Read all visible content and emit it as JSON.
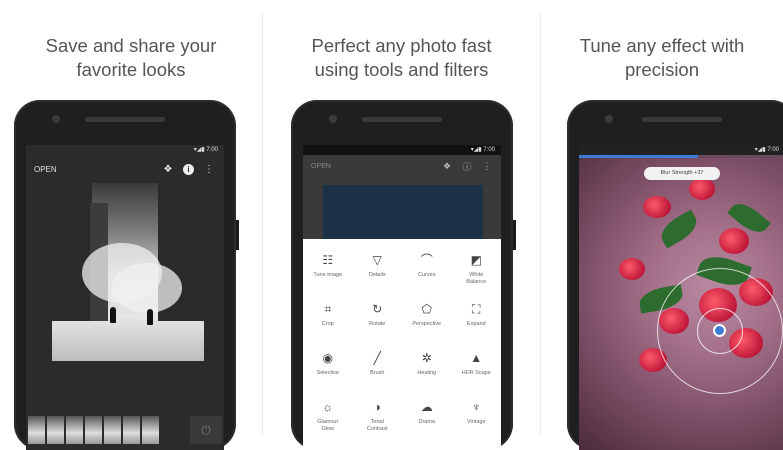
{
  "panels": [
    {
      "caption_line1": "Save and share your",
      "caption_line2": "favorite looks"
    },
    {
      "caption_line1": "Perfect any photo fast",
      "caption_line2": "using tools and filters"
    },
    {
      "caption_line1": "Tune any effect with",
      "caption_line2": "precision"
    }
  ],
  "phone1": {
    "status_time": "7:00",
    "open_label": "OPEN",
    "icons": [
      "stack-icon",
      "info-icon",
      "more-icon"
    ]
  },
  "phone2": {
    "status_time": "7:00",
    "open_label": "OPEN",
    "tools": [
      {
        "label": "Tune image",
        "icon": "☷"
      },
      {
        "label": "Details",
        "icon": "▽"
      },
      {
        "label": "Curves",
        "icon": "⌒"
      },
      {
        "label": "White Balance",
        "icon": "◩"
      },
      {
        "label": "Crop",
        "icon": "⌗"
      },
      {
        "label": "Rotate",
        "icon": "↻"
      },
      {
        "label": "Perspective",
        "icon": "⬠"
      },
      {
        "label": "Expand",
        "icon": "⛶"
      },
      {
        "label": "Selective",
        "icon": "◉"
      },
      {
        "label": "Brush",
        "icon": "╱"
      },
      {
        "label": "Healing",
        "icon": "✲"
      },
      {
        "label": "HDR Scape",
        "icon": "▲"
      },
      {
        "label": "Glamour Glow",
        "icon": "☼"
      },
      {
        "label": "Tonal Contrast",
        "icon": "◑"
      },
      {
        "label": "Drama",
        "icon": "☁"
      },
      {
        "label": "Vintage",
        "icon": "♆"
      }
    ]
  },
  "phone3": {
    "status_time": "7:00",
    "pill_label": "Blur Strength +37"
  }
}
